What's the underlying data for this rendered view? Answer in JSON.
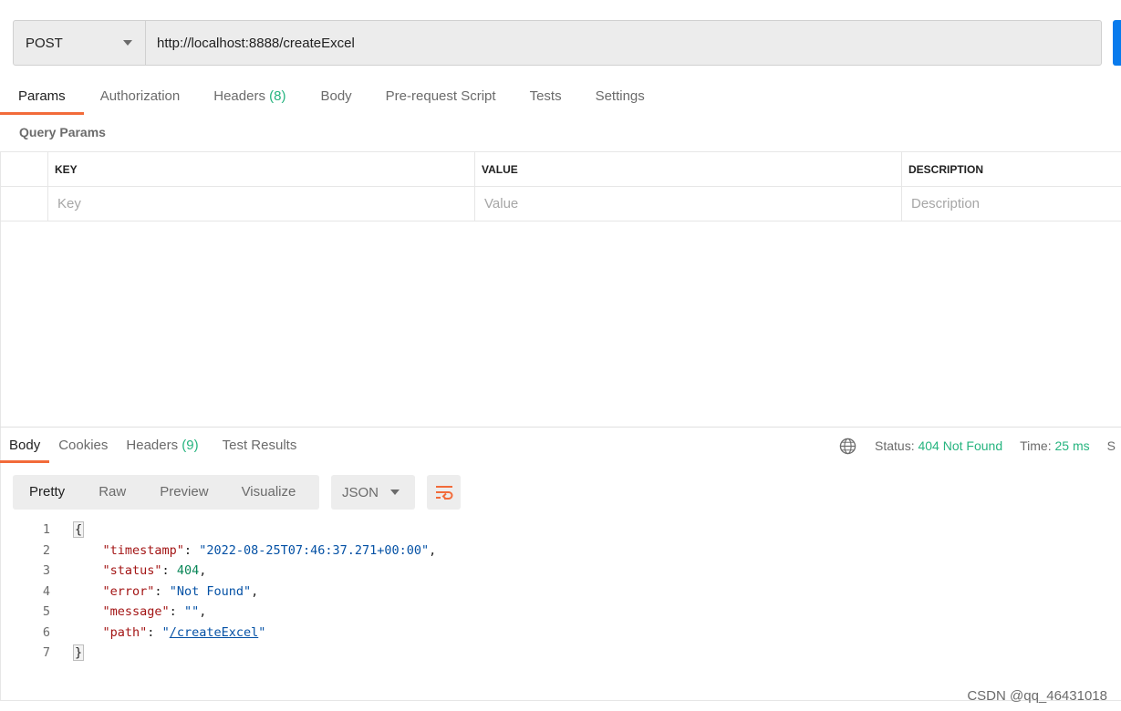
{
  "request": {
    "method": "POST",
    "url": "http://localhost:8888/createExcel"
  },
  "request_tabs": [
    {
      "label": "Params",
      "count": ""
    },
    {
      "label": "Authorization",
      "count": ""
    },
    {
      "label": "Headers",
      "count": "(8)"
    },
    {
      "label": "Body",
      "count": ""
    },
    {
      "label": "Pre-request Script",
      "count": ""
    },
    {
      "label": "Tests",
      "count": ""
    },
    {
      "label": "Settings",
      "count": ""
    }
  ],
  "query_params": {
    "title": "Query Params",
    "columns": [
      "KEY",
      "VALUE",
      "DESCRIPTION"
    ],
    "placeholders": {
      "key": "Key",
      "value": "Value",
      "description": "Description"
    }
  },
  "response_tabs": [
    {
      "label": "Body",
      "count": ""
    },
    {
      "label": "Cookies",
      "count": ""
    },
    {
      "label": "Headers",
      "count": "(9)"
    },
    {
      "label": "Test Results",
      "count": ""
    }
  ],
  "status": {
    "status_label": "Status:",
    "status_value": "404 Not Found",
    "time_label": "Time:",
    "time_value": "25 ms",
    "size_label_partial": "S"
  },
  "view_modes": [
    "Pretty",
    "Raw",
    "Preview",
    "Visualize"
  ],
  "language": "JSON",
  "body_lines": [
    {
      "n": "1"
    },
    {
      "n": "2",
      "key": "\"timestamp\"",
      "value": "\"2022-08-25T07:46:37.271+00:00\""
    },
    {
      "n": "3",
      "key": "\"status\"",
      "value": "404"
    },
    {
      "n": "4",
      "key": "\"error\"",
      "value": "\"Not Found\""
    },
    {
      "n": "5",
      "key": "\"message\"",
      "value": "\"\""
    },
    {
      "n": "6",
      "key": "\"path\"",
      "value_open": "\"",
      "value_link": "/createExcel",
      "value_close": "\""
    },
    {
      "n": "7"
    }
  ],
  "body_open": "{",
  "body_close": "}",
  "watermark": "CSDN @qq_46431018",
  "colors": {
    "accent_tab": "#f26b3a",
    "success_green": "#26b47f",
    "send_blue": "#097bed"
  }
}
